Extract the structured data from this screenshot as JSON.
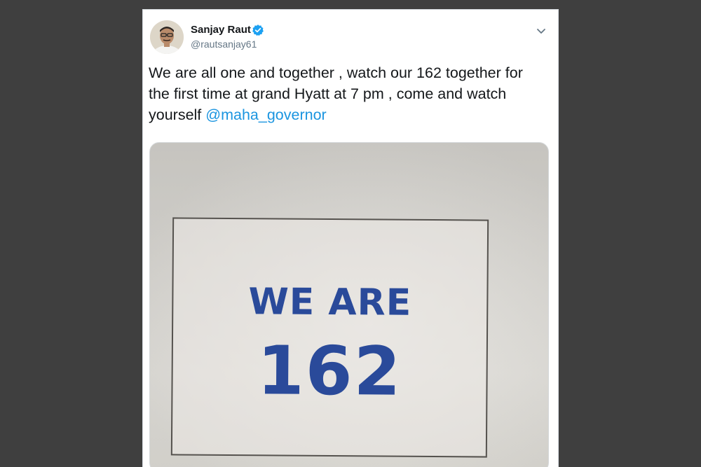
{
  "tweet": {
    "author_name": "Sanjay Raut",
    "author_handle": "@rautsanjay61",
    "text_before_mention": "We are all one and together , watch our 162 together for the first time at grand Hyatt at 7 pm , come and watch yourself ",
    "mention": "@maha_governor",
    "icons": {
      "verified": "verified-badge-icon",
      "more": "chevron-down-icon"
    },
    "colors": {
      "link": "#1b95e0",
      "verified": "#1da1f2",
      "text": "#14171a",
      "handle": "#657786"
    }
  },
  "media": {
    "line1": "WE ARE",
    "line2": "162",
    "text_color": "#2a4a9a"
  }
}
